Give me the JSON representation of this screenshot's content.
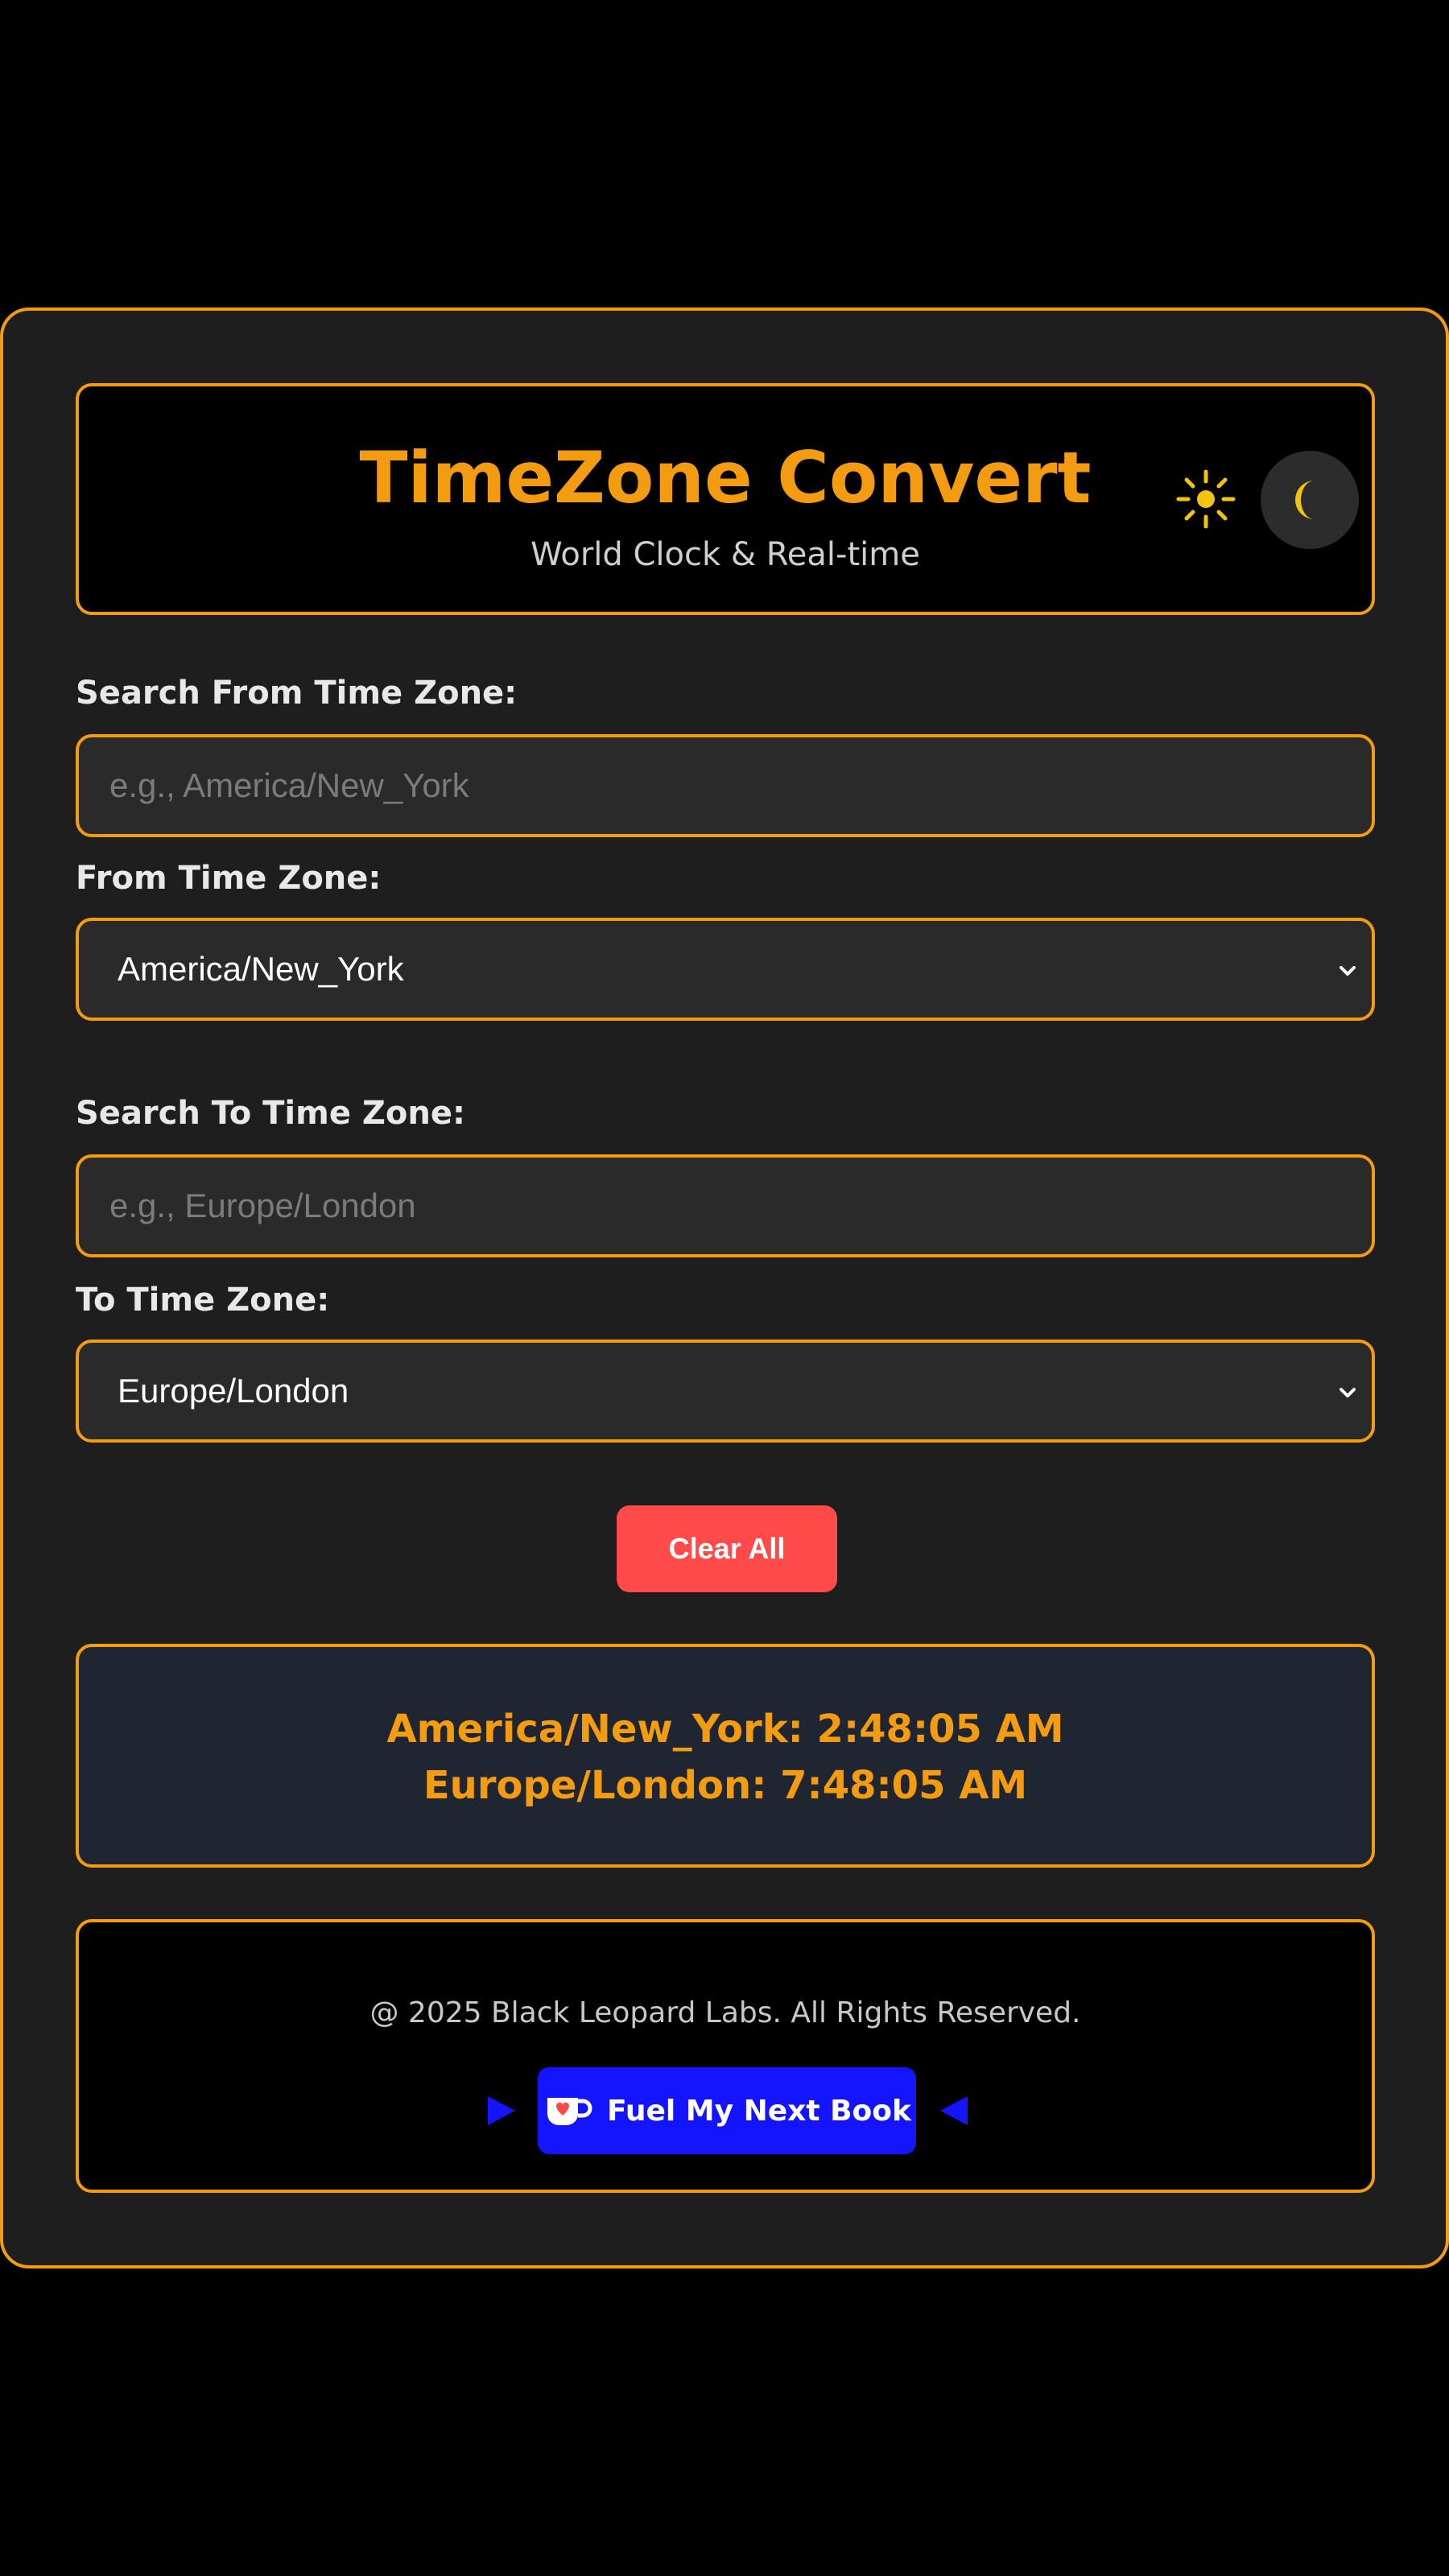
{
  "header": {
    "title": "TimeZone Convert",
    "subtitle": "World Clock & Real-time",
    "icons": {
      "light_mode": "sun-icon",
      "dark_mode": "moon-icon"
    }
  },
  "from": {
    "search_label": "Search From Time Zone:",
    "search_placeholder": "e.g., America/New_York",
    "search_value": "",
    "select_label": "From Time Zone:",
    "selected": "America/New_York"
  },
  "to": {
    "search_label": "Search To Time Zone:",
    "search_placeholder": "e.g., Europe/London",
    "search_value": "",
    "select_label": "To Time Zone:",
    "selected": "Europe/London"
  },
  "actions": {
    "clear_label": "Clear All"
  },
  "result": {
    "line1": "America/New_York: 2:48:05 AM",
    "line2": "Europe/London: 7:48:05 AM"
  },
  "footer": {
    "copyright": "@ 2025 Black Leopard Labs. All Rights Reserved.",
    "button_label": "Fuel My Next Book",
    "button_icon": "coffee-cup-icon"
  },
  "colors": {
    "accent": "#f39c12",
    "page_bg": "#000000",
    "card_bg": "#1e1e1e",
    "input_bg": "#2a2a2a",
    "result_bg": "#1f2631",
    "clear_button": "#ff4a4a",
    "support_button": "#1414ff"
  }
}
